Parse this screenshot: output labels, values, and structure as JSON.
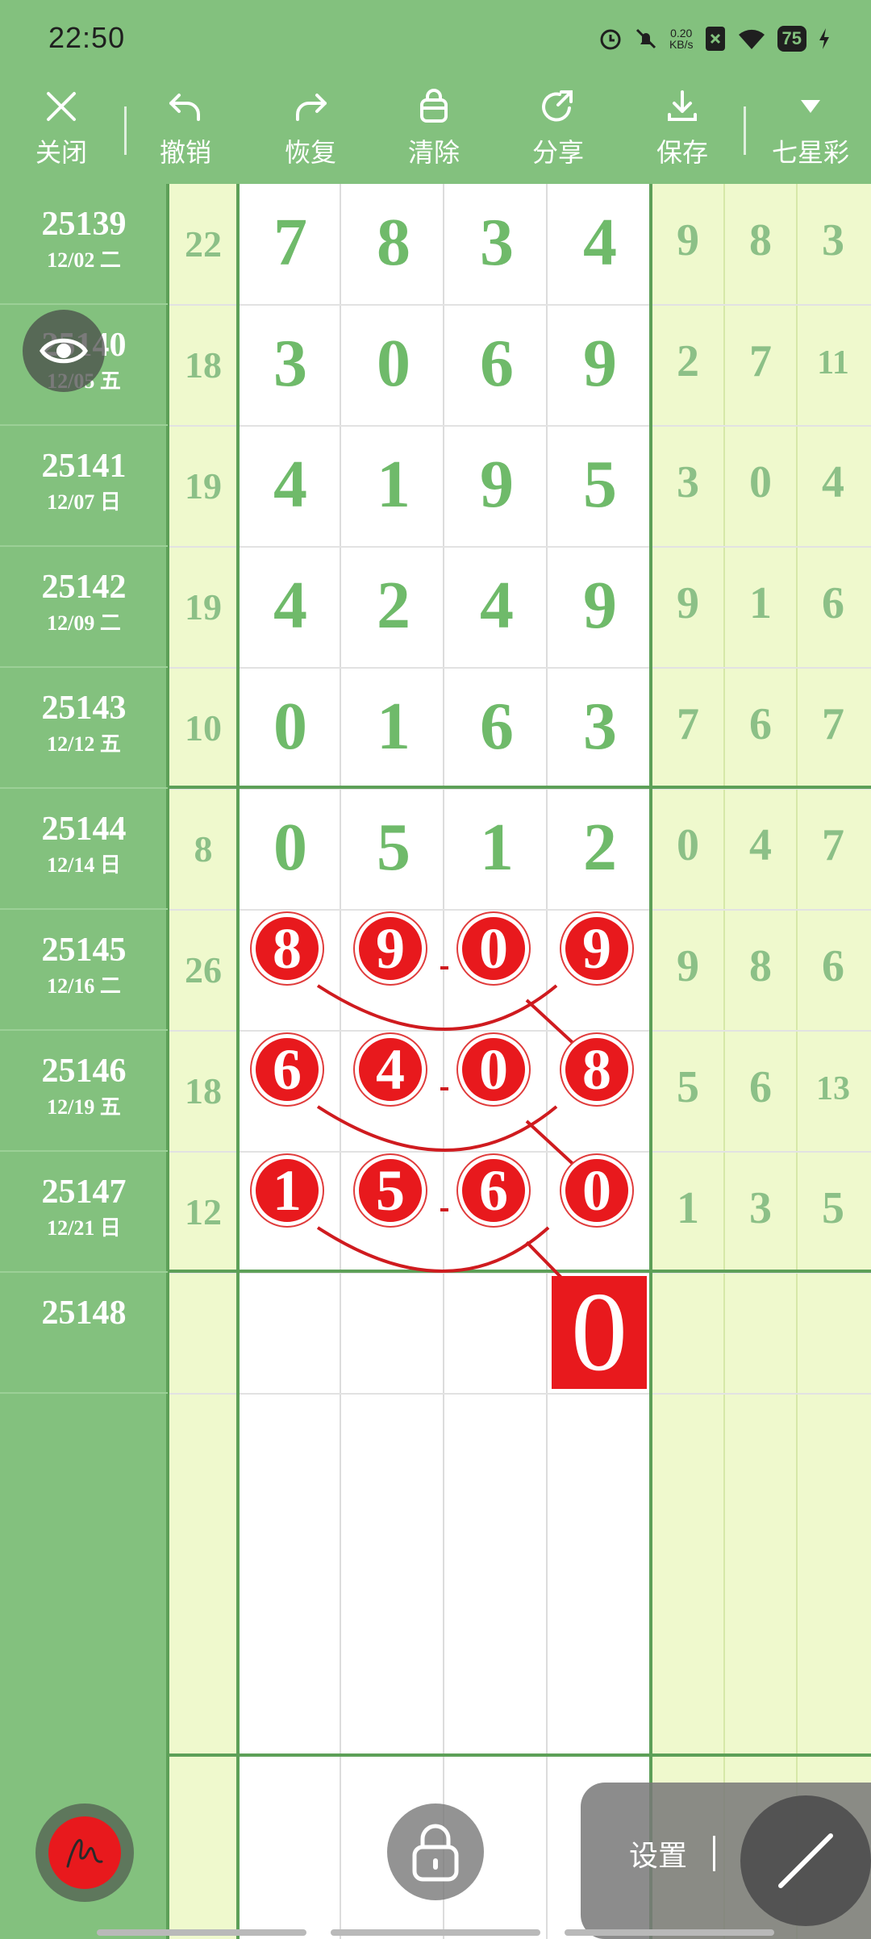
{
  "status_bar": {
    "time": "22:50",
    "net_speed_value": "0.20",
    "net_speed_unit": "KB/s",
    "battery": "75",
    "icons": [
      "alarm-icon",
      "mute-icon",
      "net-speed-icon",
      "app-notification-icon",
      "wifi-icon",
      "battery-icon",
      "charging-icon"
    ]
  },
  "toolbar": {
    "close": "关闭",
    "undo": "撤销",
    "redo": "恢复",
    "clear": "清除",
    "share": "分享",
    "save": "保存",
    "lottery": "七星彩"
  },
  "rows": [
    {
      "period": "25139",
      "date": "12/02 二",
      "sum": "22",
      "draw": [
        "7",
        "8",
        "3",
        "4"
      ],
      "extra": [
        "9",
        "8",
        "3"
      ]
    },
    {
      "period": "25140",
      "date": "12/05 五",
      "sum": "18",
      "draw": [
        "3",
        "0",
        "6",
        "9"
      ],
      "extra": [
        "2",
        "7",
        "11"
      ]
    },
    {
      "period": "25141",
      "date": "12/07 日",
      "sum": "19",
      "draw": [
        "4",
        "1",
        "9",
        "5"
      ],
      "extra": [
        "3",
        "0",
        "4"
      ]
    },
    {
      "period": "25142",
      "date": "12/09 二",
      "sum": "19",
      "draw": [
        "4",
        "2",
        "4",
        "9"
      ],
      "extra": [
        "9",
        "1",
        "6"
      ]
    },
    {
      "period": "25143",
      "date": "12/12 五",
      "sum": "10",
      "draw": [
        "0",
        "1",
        "6",
        "3"
      ],
      "extra": [
        "7",
        "6",
        "7"
      ]
    },
    {
      "period": "25144",
      "date": "12/14 日",
      "sum": "8",
      "draw": [
        "0",
        "5",
        "1",
        "2"
      ],
      "extra": [
        "0",
        "4",
        "7"
      ]
    },
    {
      "period": "25145",
      "date": "12/16 二",
      "sum": "26",
      "draw": [
        "8",
        "9",
        "0",
        "9"
      ],
      "extra": [
        "9",
        "8",
        "6"
      ],
      "marked": true
    },
    {
      "period": "25146",
      "date": "12/19 五",
      "sum": "18",
      "draw": [
        "6",
        "4",
        "0",
        "8"
      ],
      "extra": [
        "5",
        "6",
        "13"
      ],
      "marked": true
    },
    {
      "period": "25147",
      "date": "12/21 日",
      "sum": "12",
      "draw": [
        "1",
        "5",
        "6",
        "0"
      ],
      "extra": [
        "1",
        "3",
        "5"
      ],
      "marked": true
    },
    {
      "period": "25148",
      "date": "",
      "sum": "",
      "draw": [
        "",
        "",
        "",
        ""
      ],
      "extra": [
        "",
        "",
        ""
      ]
    }
  ],
  "prediction": "0",
  "colors": {
    "header_green": "#83c17e",
    "digit_green": "#6fba6a",
    "light_yellow": "#eff9cd",
    "ball_red": "#e8191d"
  },
  "floating": {
    "settings_label": "设置",
    "eye_icon": "eye-icon",
    "pen_icon": "pen-icon",
    "lock_icon": "lock-icon",
    "line_tool_icon": "line-tool-icon"
  }
}
